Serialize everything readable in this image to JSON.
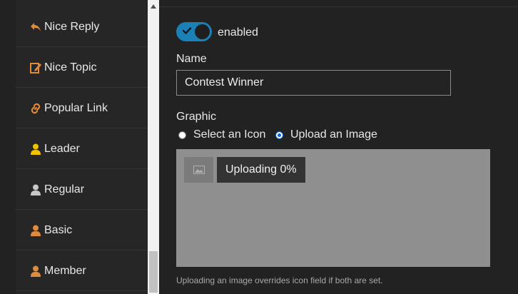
{
  "sidebar": {
    "items": [
      {
        "label": "Nice Reply",
        "icon": "reply-icon",
        "color": "#e08a3c"
      },
      {
        "label": "Nice Topic",
        "icon": "edit-topic-icon",
        "color": "#e08a3c"
      },
      {
        "label": "Popular Link",
        "icon": "link-icon",
        "color": "#e08a3c"
      },
      {
        "label": "Leader",
        "icon": "user-icon",
        "color": "#f2c200"
      },
      {
        "label": "Regular",
        "icon": "user-icon",
        "color": "#c8c8c8"
      },
      {
        "label": "Basic",
        "icon": "user-icon",
        "color": "#e08a3c"
      },
      {
        "label": "Member",
        "icon": "user-icon",
        "color": "#e08a3c"
      }
    ]
  },
  "form": {
    "toggle_label": "enabled",
    "toggle_color": "#1a80b6",
    "name_label": "Name",
    "name_value": "Contest Winner",
    "graphic_label": "Graphic",
    "option_icon": "Select an Icon",
    "option_image": "Upload an Image",
    "selected_option": "Upload an Image",
    "upload_status": "Uploading 0%",
    "upload_progress_percent": 0,
    "help_text": "Uploading an image overrides icon field if both are set."
  }
}
